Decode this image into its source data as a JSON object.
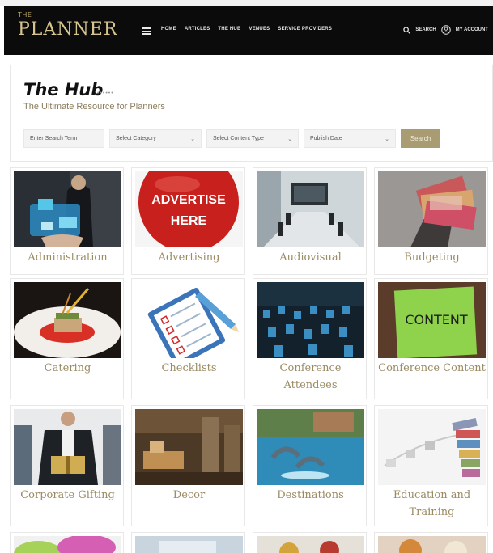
{
  "header": {
    "logo": {
      "the": "THE",
      "mark": "PLANNER",
      "tagline": ""
    },
    "nav": [
      "Home",
      "Articles",
      "The Hub",
      "Venues",
      "Service Providers"
    ],
    "search_label": "Search",
    "account_label": "My Account",
    "hamburger_icon": "hamburger-icon",
    "search_icon": "search-icon",
    "account_icon": "user-icon"
  },
  "hub": {
    "title": "The Hub",
    "title_dots": "••••••",
    "subtitle": "The Ultimate Resource for Planners",
    "filters": {
      "search_placeholder": "Enter Search Term",
      "category": "Select Category",
      "content_type": "Select Content Type",
      "publish_date": "Publish Date",
      "button": "Search"
    }
  },
  "categories": [
    {
      "label": "Administration"
    },
    {
      "label": "Advertising",
      "image_text": [
        "ADVERTISE",
        "HERE"
      ]
    },
    {
      "label": "Audiovisual"
    },
    {
      "label": "Budgeting"
    },
    {
      "label": "Catering"
    },
    {
      "label": "Checklists"
    },
    {
      "label": "Conference Attendees"
    },
    {
      "label": "Conference Content",
      "image_text": [
        "CONTENT"
      ]
    },
    {
      "label": "Corporate Gifting"
    },
    {
      "label": "Decor"
    },
    {
      "label": "Destinations"
    },
    {
      "label": "Education and Training"
    }
  ],
  "colors": {
    "header_bg": "#0b0b0b",
    "gold": "#a99b72",
    "label": "#9a8b63"
  }
}
